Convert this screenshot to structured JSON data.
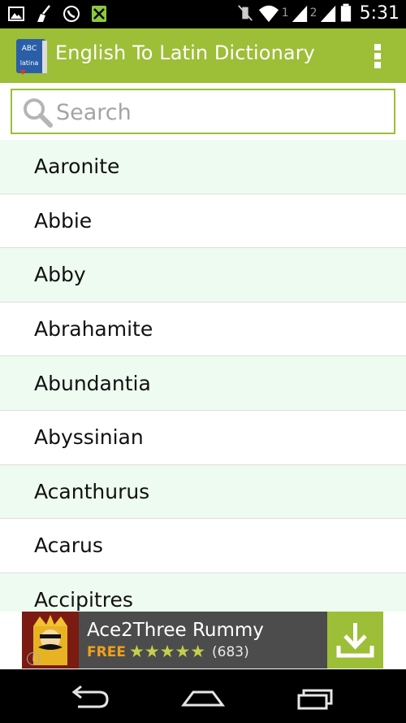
{
  "status_bar": {
    "time": "5:31",
    "sim1": "1",
    "sim2": "2",
    "left_icons": [
      "image-icon",
      "broom-icon",
      "whatsapp-icon",
      "no-sim-icon"
    ],
    "right_icons": [
      "mute-icon",
      "wifi-icon",
      "signal-icon",
      "battery-icon"
    ]
  },
  "action_bar": {
    "title": "English To Latin Dictionary",
    "app_icon_text_top": "ABC",
    "app_icon_text_bottom": "latina",
    "accent_color": "#9dbe37"
  },
  "search": {
    "placeholder": "Search",
    "value": ""
  },
  "words": [
    "Aaronite",
    "Abbie",
    "Abby",
    "Abrahamite",
    "Abundantia",
    "Abyssinian",
    "Acanthurus",
    "Acarus",
    "Accipitres"
  ],
  "ad": {
    "title": "Ace2Three Rummy",
    "price": "FREE",
    "stars": "★★★★★",
    "rating": 4.5,
    "reviews": "(683)",
    "info": "i"
  },
  "nav_bar": {
    "buttons": [
      "back-icon",
      "home-icon",
      "recents-icon"
    ]
  }
}
